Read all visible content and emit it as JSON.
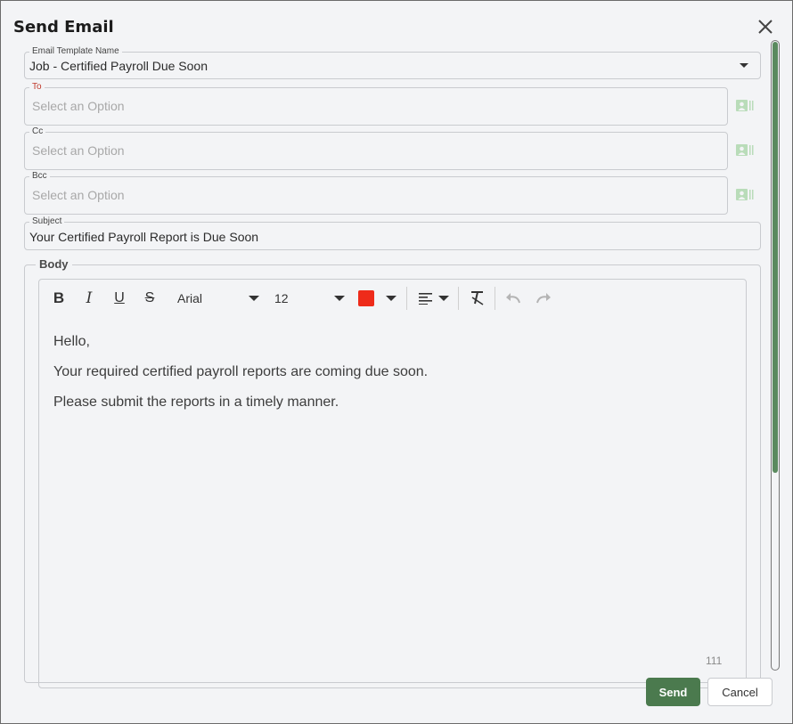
{
  "dialog": {
    "title": "Send Email"
  },
  "template": {
    "label": "Email Template Name",
    "value": "Job - Certified Payroll Due Soon"
  },
  "to": {
    "label": "To",
    "placeholder": "Select an Option"
  },
  "cc": {
    "label": "Cc",
    "placeholder": "Select an Option"
  },
  "bcc": {
    "label": "Bcc",
    "placeholder": "Select an Option"
  },
  "subject": {
    "label": "Subject",
    "value": "Your Certified Payroll Report is Due Soon"
  },
  "body": {
    "label": "Body",
    "toolbar": {
      "bold": "B",
      "italic": "I",
      "underline": "U",
      "strike": "S",
      "font": "Arial",
      "size": "12",
      "text_color": "#ee2b1a"
    },
    "lines": [
      "Hello,",
      "Your required certified payroll reports are coming due soon.",
      "Please submit the reports in a timely manner."
    ],
    "char_count": "111"
  },
  "buttons": {
    "send": "Send",
    "cancel": "Cancel"
  },
  "colors": {
    "accent": "#4b7a4e",
    "contact_icon": "#b9dcb9"
  },
  "icons": [
    "close-icon",
    "chevron-down-icon",
    "contact-card-icon",
    "align-left-icon",
    "clear-format-icon",
    "undo-icon",
    "redo-icon"
  ]
}
